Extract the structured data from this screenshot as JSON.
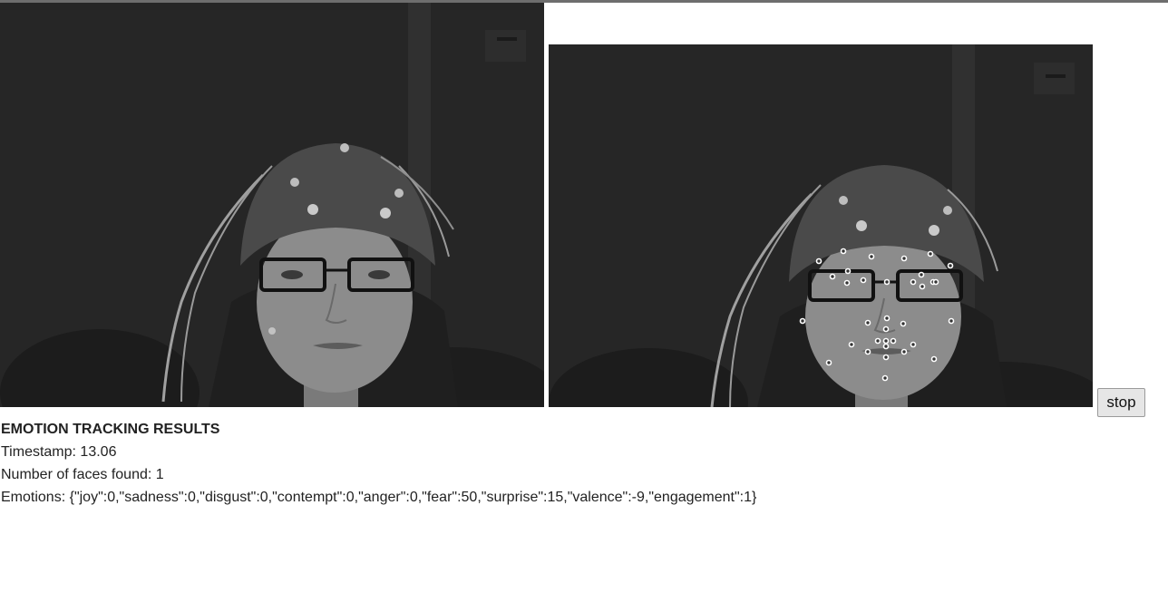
{
  "controls": {
    "stop_label": "stop"
  },
  "results": {
    "heading": "EMOTION TRACKING RESULTS",
    "timestamp_label": "Timestamp: ",
    "timestamp_value": "13.06",
    "faces_label": "Number of faces found: ",
    "faces_value": "1",
    "emotions_label": "Emotions: ",
    "emotions_value": "{\"joy\":0,\"sadness\":0,\"disgust\":0,\"contempt\":0,\"anger\":0,\"fear\":50,\"surprise\":15,\"valence\":-9,\"engagement\":1}"
  },
  "colors": {
    "video_bg": "#262626",
    "landmark": "#ffffff",
    "button_bg": "#e6e6e6"
  }
}
